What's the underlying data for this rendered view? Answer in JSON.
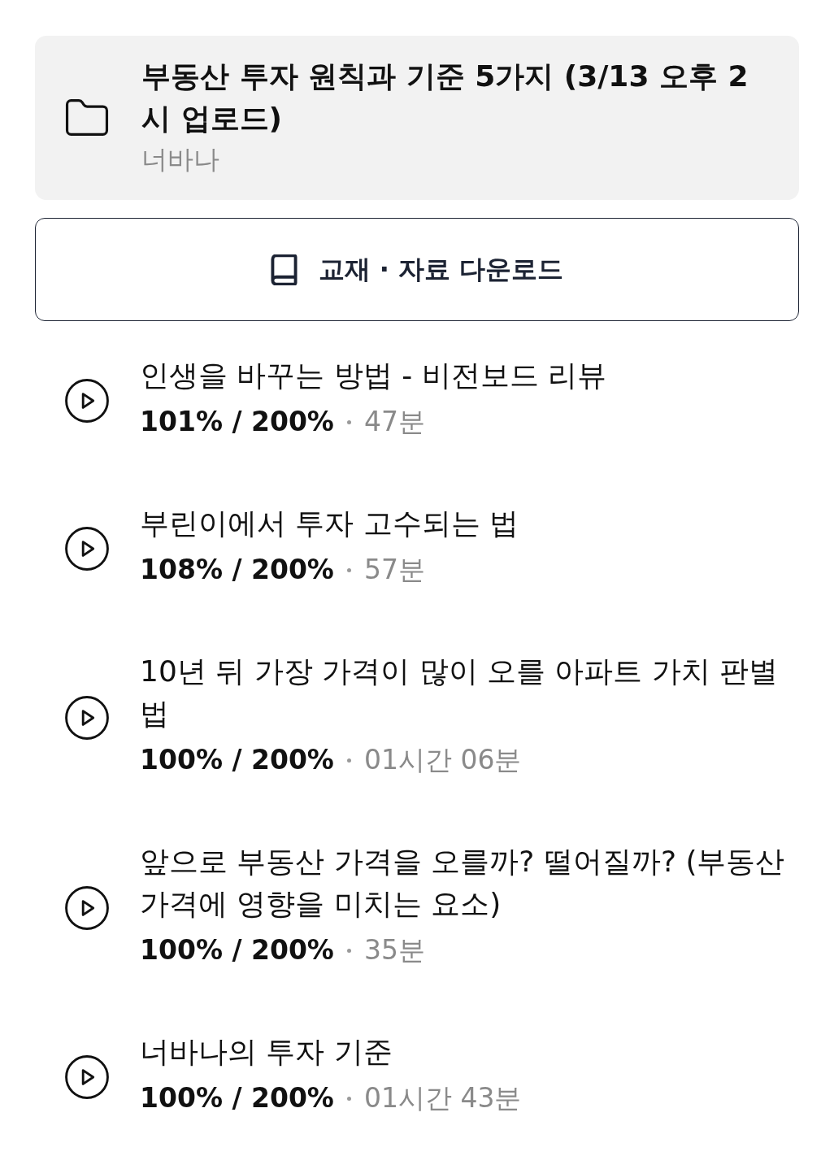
{
  "folder": {
    "title": "부동산 투자 원칙과 기준 5가지 (3/13 오후 2시 업로드)",
    "author": "너바나"
  },
  "download_button": {
    "label": "교재 · 자료 다운로드"
  },
  "lectures": [
    {
      "title": "인생을 바꾸는 방법 - 비전보드 리뷰",
      "progress": "101% / 200%",
      "duration": "47분"
    },
    {
      "title": "부린이에서 투자 고수되는 법",
      "progress": "108% / 200%",
      "duration": "57분"
    },
    {
      "title": "10년 뒤 가장 가격이 많이 오를 아파트 가치 판별법",
      "progress": "100% / 200%",
      "duration": "01시간 06분"
    },
    {
      "title": "앞으로 부동산 가격을 오를까? 떨어질까? (부동산 가격에 영향을 미치는 요소)",
      "progress": "100% / 200%",
      "duration": "35분"
    },
    {
      "title": "너바나의 투자 기준",
      "progress": "100% / 200%",
      "duration": "01시간 43분"
    }
  ]
}
